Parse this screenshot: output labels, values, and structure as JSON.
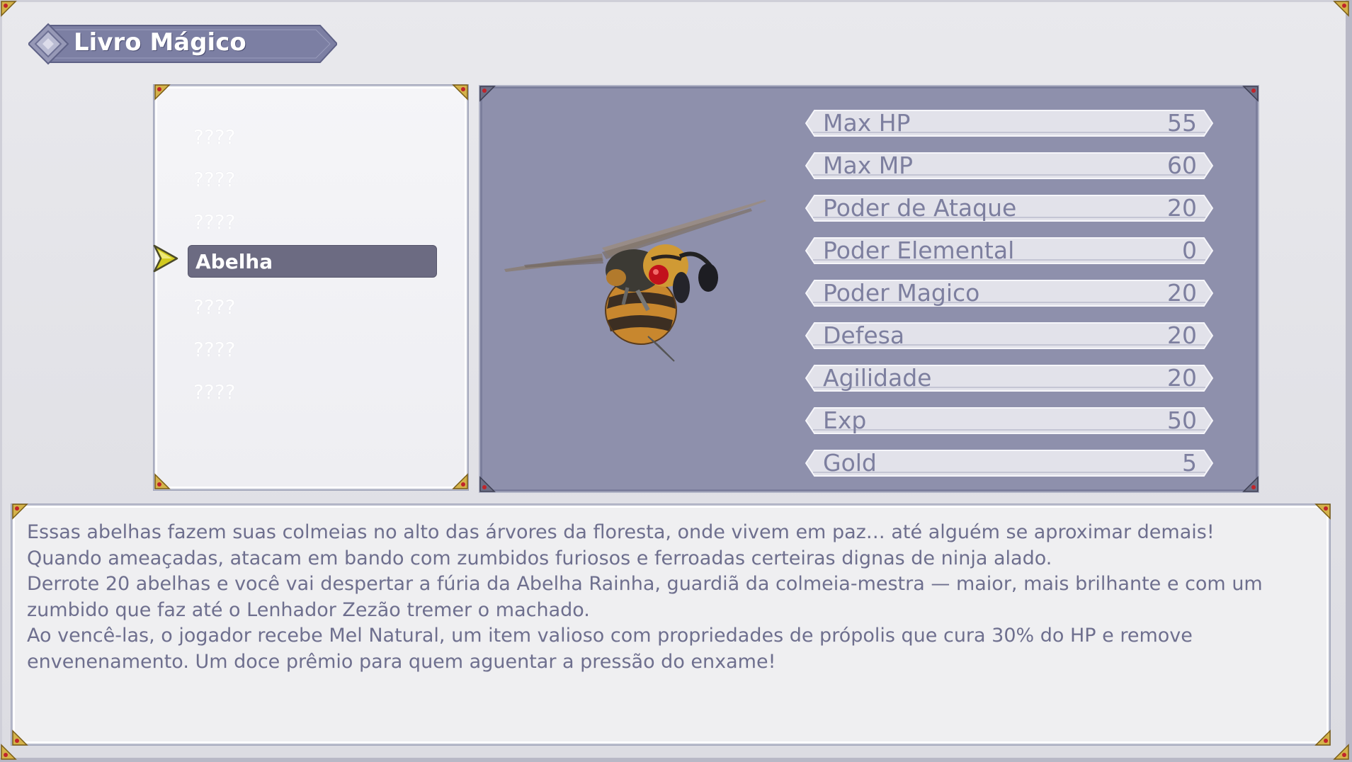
{
  "window": {
    "title": "Livro Mágico"
  },
  "bestiary_list": {
    "items": [
      {
        "label": "????",
        "selected": false
      },
      {
        "label": "????",
        "selected": false
      },
      {
        "label": "????",
        "selected": false
      },
      {
        "label": "Abelha",
        "selected": true
      },
      {
        "label": "????",
        "selected": false
      },
      {
        "label": "????",
        "selected": false
      },
      {
        "label": "????",
        "selected": false
      }
    ]
  },
  "enemy": {
    "sprite": "bee-sprite",
    "stats": [
      {
        "label": "Max HP",
        "value": "55"
      },
      {
        "label": "Max MP",
        "value": "60"
      },
      {
        "label": "Poder de Ataque",
        "value": "20"
      },
      {
        "label": "Poder Elemental",
        "value": "0"
      },
      {
        "label": "Poder Magico",
        "value": "20"
      },
      {
        "label": "Defesa",
        "value": "20"
      },
      {
        "label": "Agilidade",
        "value": "20"
      },
      {
        "label": "Exp",
        "value": "50"
      },
      {
        "label": "Gold",
        "value": "5"
      }
    ]
  },
  "description": {
    "text": "Essas abelhas fazem suas colmeias no alto das árvores da floresta, onde vivem em paz… até alguém se aproximar demais!\nQuando ameaçadas, atacam em bando com zumbidos furiosos e ferroadas certeiras dignas de ninja alado.\nDerrote 20 abelhas e você vai despertar a fúria da Abelha Rainha, guardiã da colmeia-mestra — maior, mais brilhante e com um zumbido que faz até o Lenhador Zezão tremer o machado.\nAo vencê-las, o jogador recebe Mel Natural, um item valioso com propriedades de própolis que cura 30% do HP e remove envenenamento. Um doce prêmio para quem aguentar a pressão do enxame!"
  },
  "colors": {
    "panel_bg": "#8e90ac",
    "stat_text": "#7d7f9f",
    "selected_bg": "#6c6b82",
    "cursor": "#c9c21a"
  }
}
